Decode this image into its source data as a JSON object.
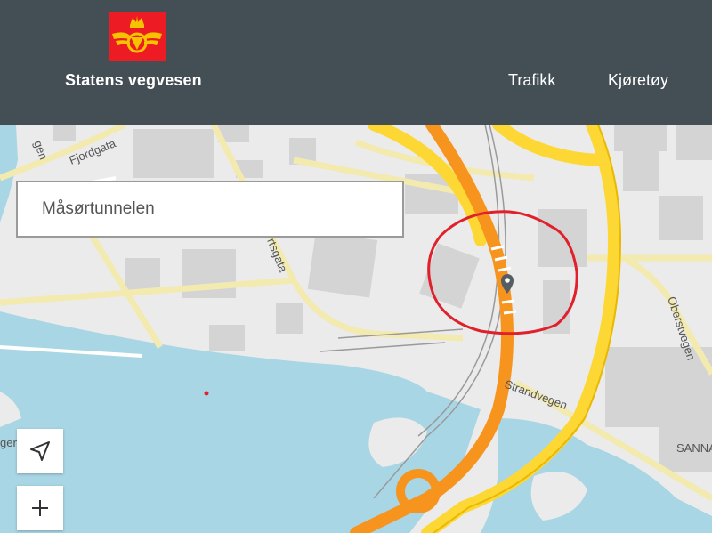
{
  "header": {
    "logo_text": "Statens vegvesen",
    "nav": [
      {
        "label": "Trafikk"
      },
      {
        "label": "Kjøretøy"
      }
    ]
  },
  "search": {
    "value": "Måsørtunnelen"
  },
  "map": {
    "street_labels": [
      "Fjordgata",
      "rtsgata",
      "Strandvegen",
      "Oberstvegen",
      "SANNA",
      "gen",
      "gen"
    ],
    "controls": {
      "locate": "locate-arrow-icon",
      "zoom_in": "+"
    }
  },
  "colors": {
    "header_bg": "#444f55",
    "brand_red": "#ed1c24",
    "brand_yellow": "#f5c400",
    "highway_orange": "#f7941d",
    "road_yellow": "#fdd835",
    "water": "#a8d5e2",
    "annotation_red": "#e0202a"
  }
}
